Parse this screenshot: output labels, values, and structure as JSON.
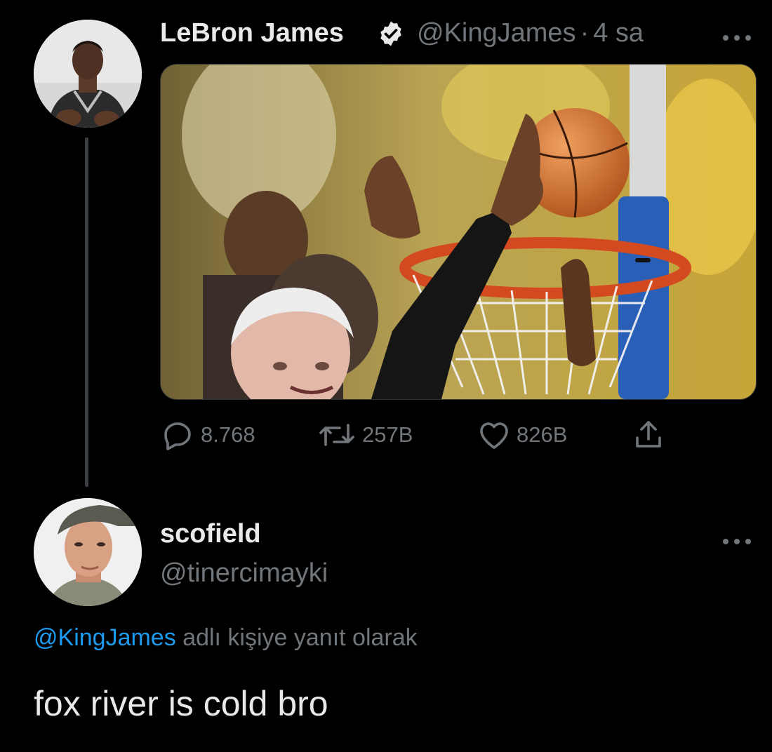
{
  "tweet": {
    "author_name": "LeBron James",
    "verified_icon": "verified-badge-icon",
    "handle": "@KingJames",
    "separator": "·",
    "time": "4 sa",
    "more_icon": "more-options-icon",
    "media_alt": "basketball-block-photo",
    "actions": {
      "reply_count": "8.768",
      "retweet_count": "257B",
      "like_count": "826B"
    },
    "icons": [
      "reply-icon",
      "retweet-icon",
      "like-icon",
      "share-icon"
    ]
  },
  "reply": {
    "author_name": "scofield",
    "handle": "@tinercimayki",
    "more_icon": "more-options-icon",
    "replying_mention": "@KingJames",
    "replying_suffix": " adlı kişiye yanıt olarak",
    "text": "fox river is cold bro"
  },
  "colors": {
    "background": "#000000",
    "primary_text": "#e7e9ea",
    "secondary_text": "#71767b",
    "link": "#1d9bf0"
  }
}
